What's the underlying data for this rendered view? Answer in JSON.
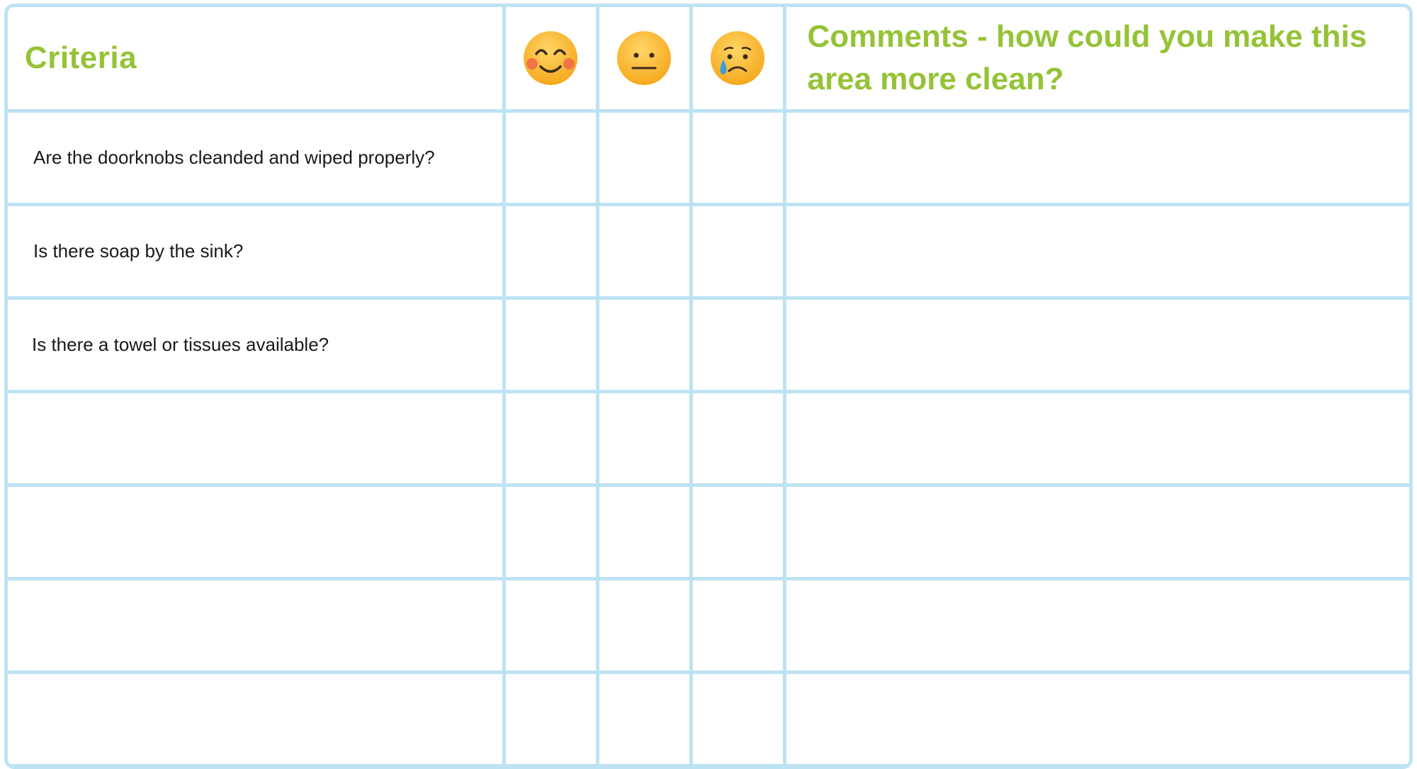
{
  "table": {
    "header": {
      "criteria": "Criteria",
      "comments": "Comments - how could  you make this area more clean?",
      "faces": [
        {
          "icon": "smiling-face-icon"
        },
        {
          "icon": "neutral-face-icon"
        },
        {
          "icon": "sad-face-icon"
        }
      ]
    },
    "rows": [
      {
        "criterion": "Are the doorknobs cleanded and wiped properly?"
      },
      {
        "criterion": "Is there soap by the sink?"
      },
      {
        "criterion": "Is there a towel or tissues available?"
      },
      {
        "criterion": ""
      },
      {
        "criterion": ""
      },
      {
        "criterion": ""
      },
      {
        "criterion": ""
      }
    ]
  },
  "colors": {
    "heading": "#95c337",
    "grid": "#bde3f3",
    "face": "#f7b52c",
    "cheek": "#ef6b4a",
    "tear": "#3aa0d8"
  }
}
